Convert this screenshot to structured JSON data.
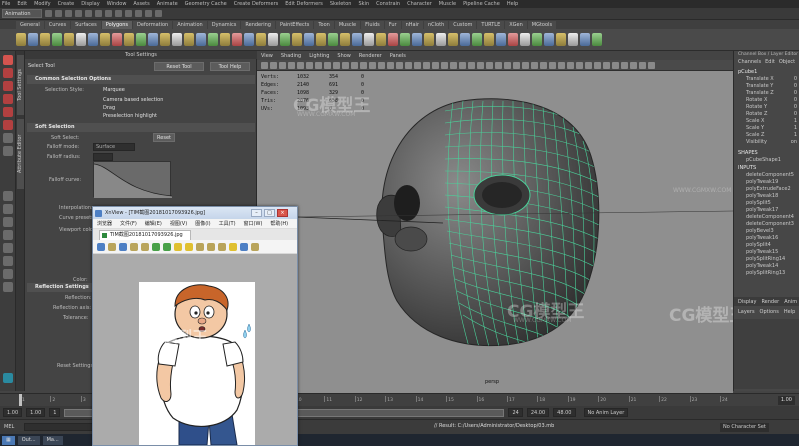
{
  "menubar": [
    "File",
    "Edit",
    "Modify",
    "Create",
    "Display",
    "Window",
    "Assets",
    "Animate",
    "Geometry Cache",
    "Create Deformers",
    "Edit Deformers",
    "Skeleton",
    "Skin",
    "Constrain",
    "Character",
    "Muscle",
    "Pipeline Cache",
    "Help"
  ],
  "status": {
    "mode": "Animation"
  },
  "shelf_tabs": [
    {
      "label": "General",
      "active": false
    },
    {
      "label": "Curves",
      "active": false
    },
    {
      "label": "Surfaces",
      "active": false
    },
    {
      "label": "Polygons",
      "active": true
    },
    {
      "label": "Deformation",
      "active": false
    },
    {
      "label": "Animation",
      "active": false
    },
    {
      "label": "Dynamics",
      "active": false
    },
    {
      "label": "Rendering",
      "active": false
    },
    {
      "label": "PaintEffects",
      "active": false
    },
    {
      "label": "Toon",
      "active": false
    },
    {
      "label": "Muscle",
      "active": false
    },
    {
      "label": "Fluids",
      "active": false
    },
    {
      "label": "Fur",
      "active": false
    },
    {
      "label": "nHair",
      "active": false
    },
    {
      "label": "nCloth",
      "active": false
    },
    {
      "label": "Custom",
      "active": false
    },
    {
      "label": "TURTLE",
      "active": false
    },
    {
      "label": "XGen",
      "active": false
    },
    {
      "label": "MGtools",
      "active": false
    }
  ],
  "vertical_tabs": [
    "Tool Settings",
    "Attribute Editor"
  ],
  "tool_settings": {
    "window_title": "Tool Settings",
    "tool_name": "Select Tool",
    "reset_label": "Reset Tool",
    "help_label": "Tool Help",
    "common_section": "Common Selection Options",
    "selection_style_label": "Selection Style:",
    "selection_style_value": "Marquee",
    "camera_based": "Camera based selection",
    "drag": "Drag",
    "preselection": "Preselection highlight",
    "soft_section": "Soft Selection",
    "soft_select_label": "Soft Select:",
    "soft_reset": "Reset",
    "falloff_mode_label": "Falloff mode:",
    "falloff_mode_value": "Surface",
    "falloff_radius_label": "Falloff radius:",
    "falloff_curve_label": "Falloff curve:",
    "interpolation_label": "Interpolation:",
    "curve_presets_label": "Curve presets:",
    "viewport_label": "Viewport color:",
    "color_label": "Color:",
    "reflection_section": "Reflection Settings",
    "reflection_label": "Reflection:",
    "reflection_axis_label": "Reflection axis:",
    "tolerance_label": "Tolerance:",
    "reset_settings": "Reset Settings"
  },
  "viewport": {
    "menu": [
      "View",
      "Shading",
      "Lighting",
      "Show",
      "Renderer",
      "Panels"
    ],
    "hud": [
      {
        "label": "Verts:",
        "v1": "1032",
        "v2": "354",
        "v3": "0"
      },
      {
        "label": "Edges:",
        "v1": "2140",
        "v2": "691",
        "v3": "0"
      },
      {
        "label": "Faces:",
        "v1": "1098",
        "v2": "329",
        "v3": "0"
      },
      {
        "label": "Tris:",
        "v1": "2076",
        "v2": "658",
        "v3": "0"
      },
      {
        "label": "UVs:",
        "v1": "1093",
        "v2": "0",
        "v3": "0"
      }
    ],
    "camera": "persp"
  },
  "channel_box": {
    "tabs": [
      "Channel Box / Layer Editor"
    ],
    "menu": [
      "Channels",
      "Edit",
      "Object",
      "Show"
    ],
    "object": "pCube1",
    "attrs": [
      {
        "name": "Translate X",
        "value": "0"
      },
      {
        "name": "Translate Y",
        "value": "0"
      },
      {
        "name": "Translate Z",
        "value": "0"
      },
      {
        "name": "Rotate X",
        "value": "0"
      },
      {
        "name": "Rotate Y",
        "value": "0"
      },
      {
        "name": "Rotate Z",
        "value": "0"
      },
      {
        "name": "Scale X",
        "value": "1"
      },
      {
        "name": "Scale Y",
        "value": "1"
      },
      {
        "name": "Scale Z",
        "value": "1"
      },
      {
        "name": "Visibility",
        "value": "on"
      }
    ],
    "shapes_label": "SHAPES",
    "shape": "pCubeShape1",
    "inputs_label": "INPUTS",
    "inputs": [
      "deleteComponent5",
      "polyTweak19",
      "polyExtrudeFace2",
      "polyTweak18",
      "polySplit5",
      "polyTweak17",
      "deleteComponent4",
      "deleteComponent3",
      "polyBevel3",
      "polyTweak16",
      "polySplit4",
      "polyTweak15",
      "polySplitRing14",
      "polyTweak14",
      "polySplitRing13"
    ],
    "layer_tabs": [
      "Display",
      "Render",
      "Anim"
    ],
    "layer_menu": [
      "Layers",
      "Options",
      "Help"
    ]
  },
  "time": {
    "start": "1.00",
    "range_start": "1.00",
    "range_start2": "1",
    "range_end": "24",
    "end_a": "24.00",
    "end_b": "48.00",
    "current": "1.00",
    "anim_layer": "No Anim Layer",
    "char_set": "No Character Set",
    "ticks": [
      "1",
      "2",
      "3",
      "4",
      "5",
      "6",
      "7",
      "8",
      "9",
      "10",
      "11",
      "12",
      "13",
      "14",
      "15",
      "16",
      "17",
      "18",
      "19",
      "20",
      "21",
      "22",
      "23",
      "24"
    ]
  },
  "command": {
    "label": "MEL",
    "result": "// Result: C:/Users/Administrator/Desktop/03.mb"
  },
  "taskbar": [
    "Out...",
    "Ma..."
  ],
  "image_viewer": {
    "title": "XnView - [TIM截图20181017093926.jpg]",
    "menu": [
      "文件(F)",
      "编辑(E)",
      "视图(V)",
      "图像(I)",
      "工具(T)",
      "窗口(W)",
      "帮助(H)"
    ],
    "menu_left": "浏览器",
    "tab_label": "TIM截图20181017093926.jpg"
  },
  "watermark": {
    "brand": "CG模型王",
    "url": "WWW.CGMXW.COM"
  },
  "colors": {
    "wire": "#4bd19a",
    "viewport_bg": "#8f8f8f",
    "selected_tool": "#d3544f"
  }
}
